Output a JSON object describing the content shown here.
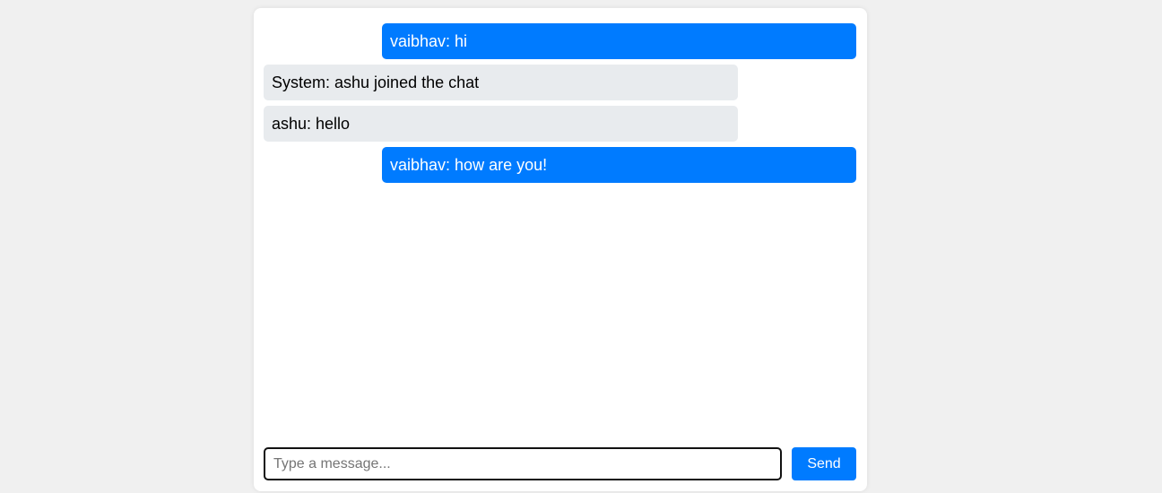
{
  "colors": {
    "page_background": "#f0f0f0",
    "card_background": "#ffffff",
    "sent_bubble": "#007bff",
    "received_bubble": "#e8ebee",
    "button": "#007bff"
  },
  "messages": [
    {
      "text": "vaibhav: hi",
      "direction": "sent"
    },
    {
      "text": "System: ashu joined the chat",
      "direction": "received"
    },
    {
      "text": "ashu: hello",
      "direction": "received"
    },
    {
      "text": "vaibhav: how are you!",
      "direction": "sent"
    }
  ],
  "composer": {
    "input_value": "",
    "placeholder": "Type a message...",
    "send_label": "Send"
  }
}
